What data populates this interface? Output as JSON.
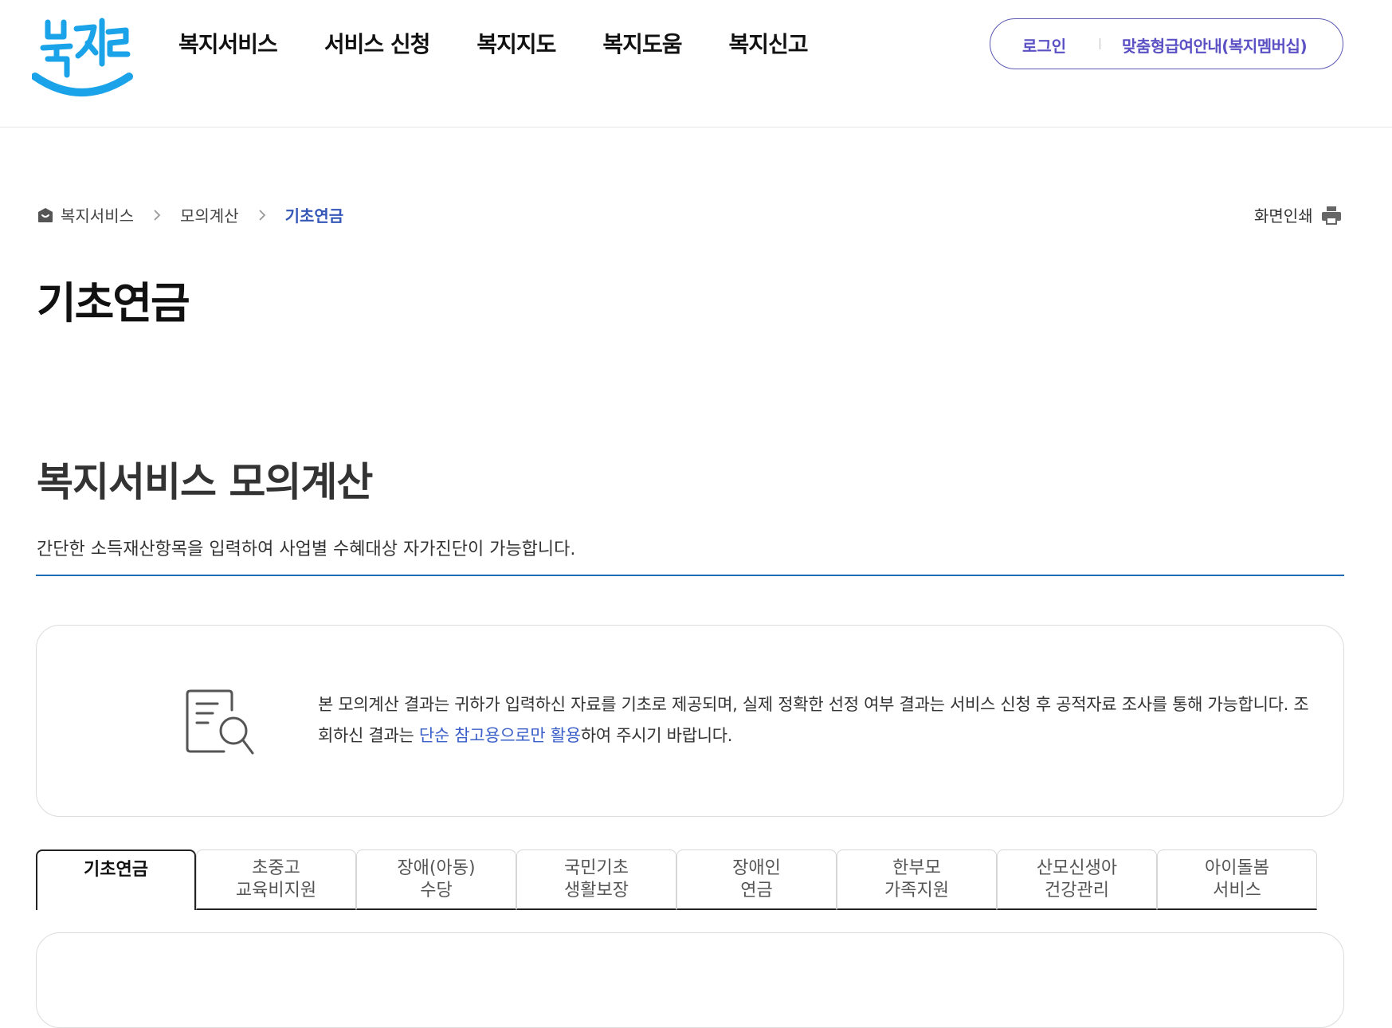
{
  "header": {
    "logo_text": "복지로",
    "nav": [
      "복지서비스",
      "서비스 신청",
      "복지지도",
      "복지도움",
      "복지신고"
    ],
    "login_label": "로그인",
    "member_label": "맞춤형급여안내(복지멤버십)"
  },
  "breadcrumb": {
    "items": [
      "복지서비스",
      "모의계산",
      "기초연금"
    ]
  },
  "print_label": "화면인쇄",
  "page_title": "기초연금",
  "section": {
    "title": "복지서비스 모의계산",
    "description": "간단한 소득재산항목을 입력하여 사업별 수혜대상 자가진단이 가능합니다."
  },
  "notice": {
    "text_before": "본 모의계산 결과는 귀하가 입력하신 자료를 기초로 제공되며, 실제 정확한 선정 여부 결과는 서비스 신청 후 공적자료 조사를 통해 가능합니다. 조회하신 결과는 ",
    "text_highlight": "단순 참고용으로만 활용",
    "text_after": "하여 주시기 바랍니다."
  },
  "tabs": [
    {
      "line1": "기초연금",
      "line2": ""
    },
    {
      "line1": "초중고",
      "line2": "교육비지원"
    },
    {
      "line1": "장애(아동)",
      "line2": "수당"
    },
    {
      "line1": "국민기초",
      "line2": "생활보장"
    },
    {
      "line1": "장애인",
      "line2": "연금"
    },
    {
      "line1": "한부모",
      "line2": "가족지원"
    },
    {
      "line1": "산모신생아",
      "line2": "건강관리"
    },
    {
      "line1": "아이돌봄",
      "line2": "서비스"
    }
  ],
  "colors": {
    "brand_blue": "#1aa3e8",
    "accent_purple": "#5b51c4",
    "link_blue": "#3a5fc8",
    "divider_blue": "#1d6ab8"
  }
}
